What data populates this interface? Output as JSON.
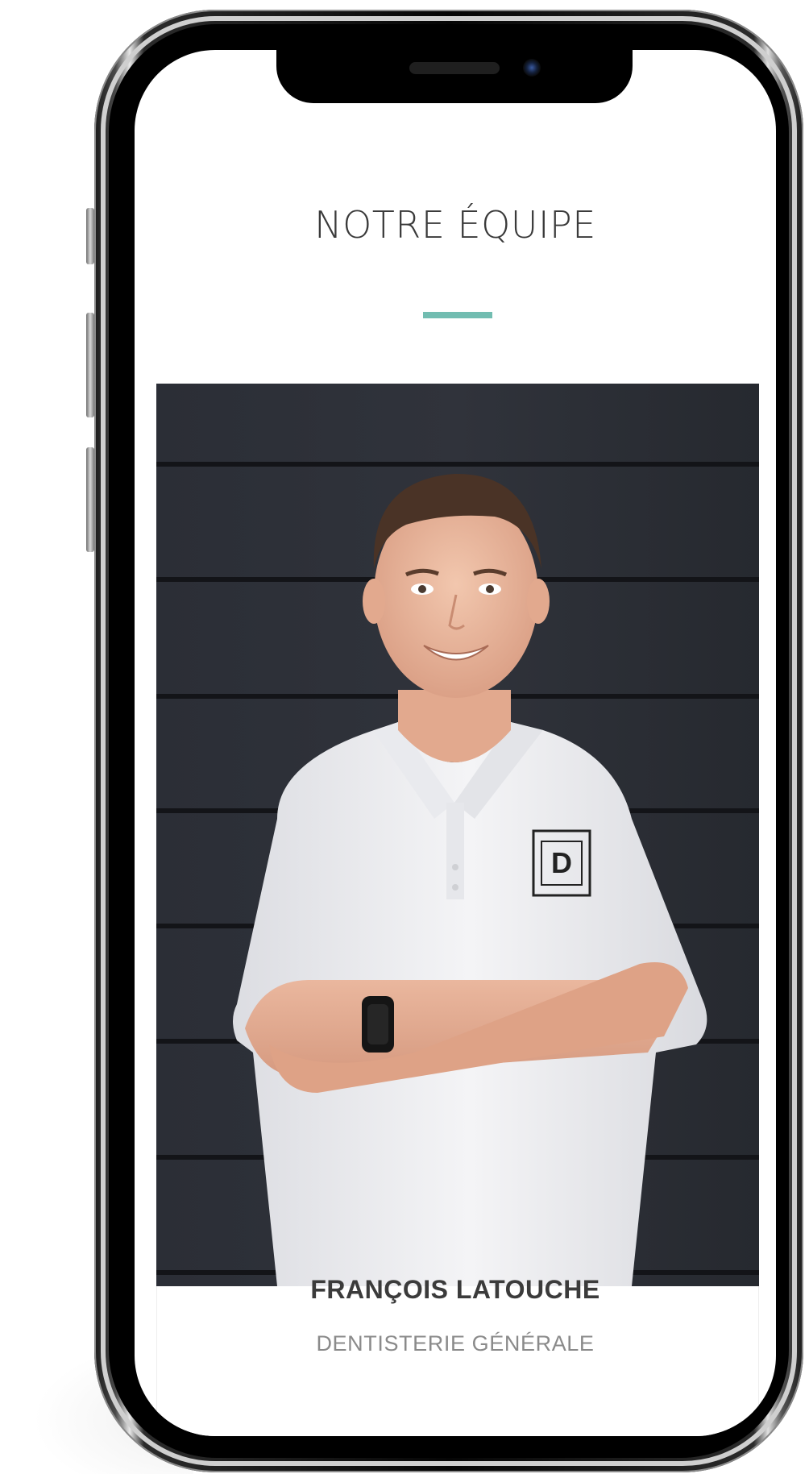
{
  "section": {
    "title": "NOTRE ÉQUIPE",
    "accent_color": "#72bdb1"
  },
  "team_member": {
    "photo": "portrait-photo",
    "name": "FRANÇOIS LATOUCHE",
    "role": "DENTISTERIE GÉNÉRALE",
    "shirt_logo_text": "D"
  },
  "device": {
    "frame": "smartphone-frame",
    "camera": "front-camera",
    "speaker": "earpiece-speaker"
  }
}
